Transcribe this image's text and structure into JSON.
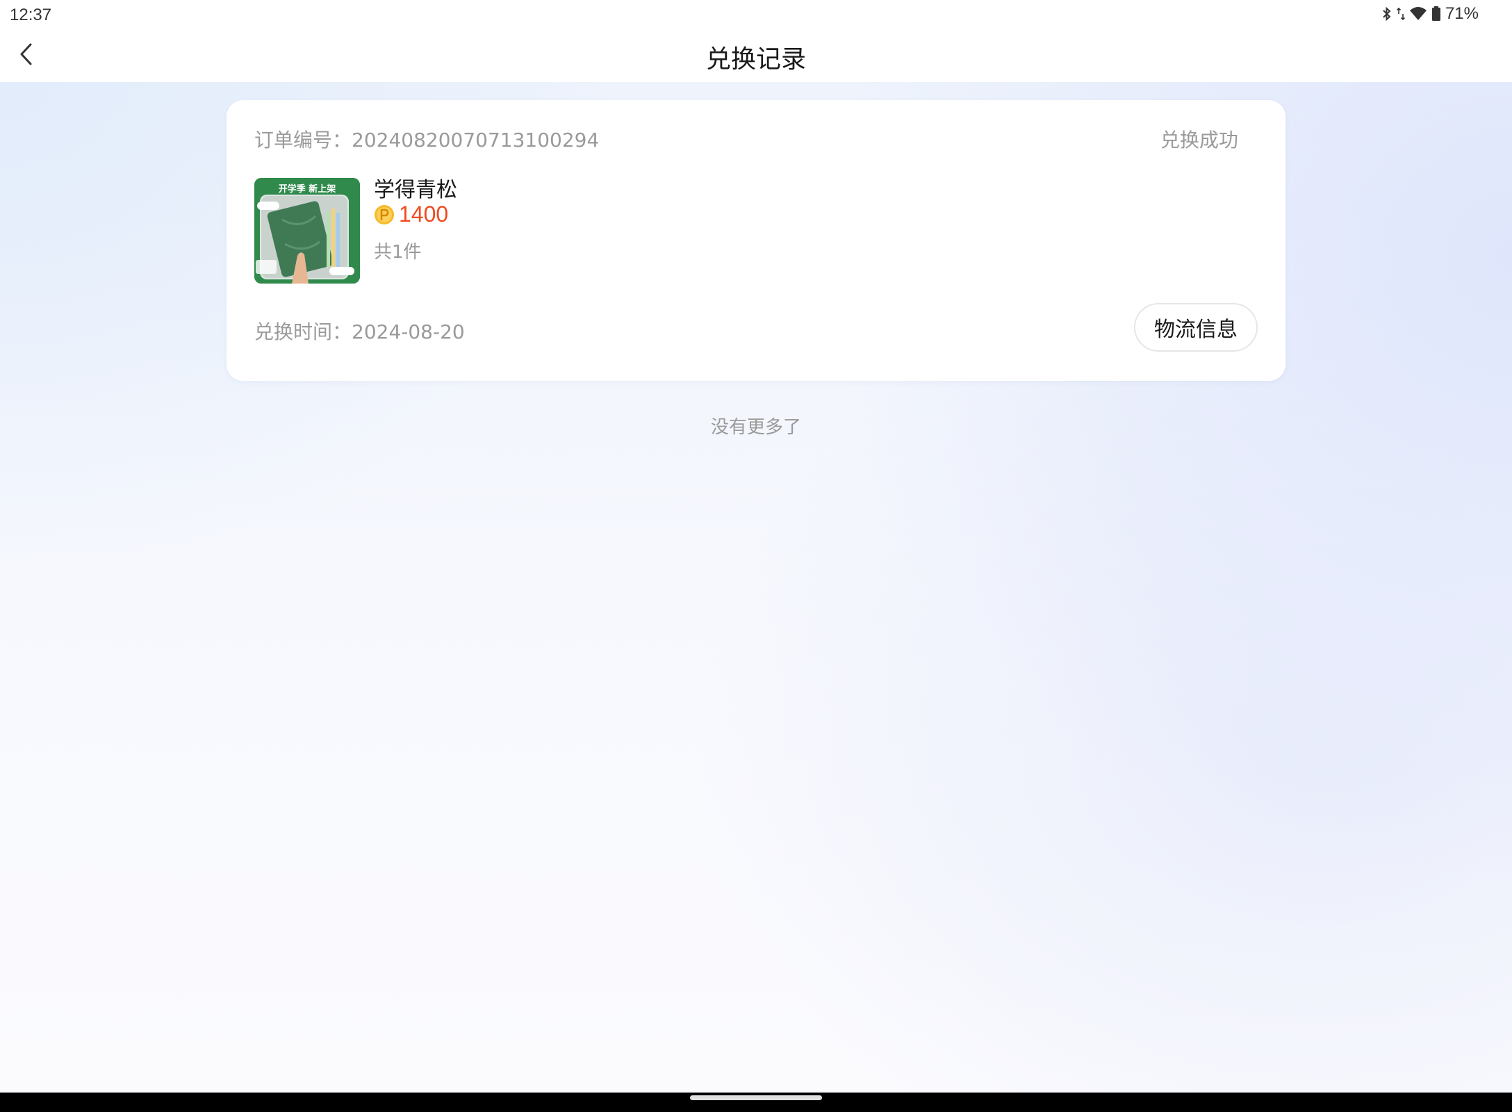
{
  "status_bar": {
    "time": "12:37",
    "battery": "71%",
    "icons": [
      "bluetooth-icon",
      "data-arrows-icon",
      "wifi-icon",
      "battery-icon"
    ]
  },
  "header": {
    "title": "兑换记录",
    "back_icon": "chevron-left-icon"
  },
  "order": {
    "order_no_label": "订单编号：20240820070713100294",
    "status": "兑换成功",
    "product": {
      "name": "学得青松",
      "price": "1400",
      "price_icon": "coin-p-icon",
      "quantity": "共1件",
      "thumb_text": "开学季 新上架"
    },
    "exchange_time_label": "兑换时间：2024-08-20",
    "logistics_button": "物流信息"
  },
  "list_footer": "没有更多了",
  "colors": {
    "price": "#f04a1e",
    "muted_text": "#9a9a9a",
    "thumb_green": "#2f8a4c"
  }
}
